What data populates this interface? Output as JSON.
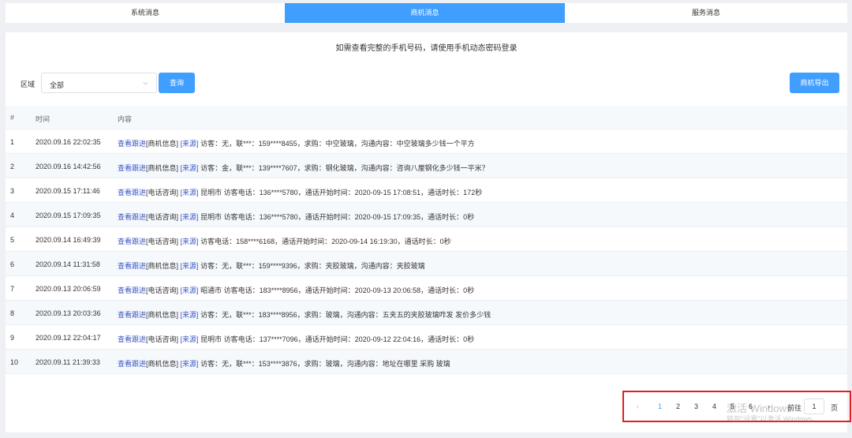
{
  "tabs": [
    {
      "label": "系统消息",
      "active": false
    },
    {
      "label": "商机消息",
      "active": true
    },
    {
      "label": "服务消息",
      "active": false
    }
  ],
  "notice": "如需查看完整的手机号码，请使用手机动态密码登录",
  "filter": {
    "label": "区域",
    "selected": "全部",
    "query_button": "查询",
    "export_button": "商机导出"
  },
  "table": {
    "headers": {
      "num": "#",
      "time": "时间",
      "content": "内容"
    },
    "rows": [
      {
        "num": "1",
        "time": "2020.09.16 22:02:35",
        "link": "查看跟进",
        "type": "[商机信息]",
        "source": "[来源]",
        "text": " 访客：无，联***：159****8455，求购：中空玻璃，沟通内容：中空玻璃多少钱一个平方"
      },
      {
        "num": "2",
        "time": "2020.09.16 14:42:56",
        "link": "查看跟进",
        "type": "[商机信息]",
        "source": "[来源]",
        "text": " 访客：金，联***：139****7607，求购：钢化玻璃，沟通内容：咨询八厘钢化多少钱一平米？"
      },
      {
        "num": "3",
        "time": "2020.09.15 17:11:46",
        "link": "查看跟进",
        "type": "[电话咨询]",
        "source": "[来源]",
        "text": " 昆明市 访客电话：136****5780，通话开始时间：2020-09-15 17:08:51，通话时长：172秒"
      },
      {
        "num": "4",
        "time": "2020.09.15 17:09:35",
        "link": "查看跟进",
        "type": "[电话咨询]",
        "source": "[来源]",
        "text": " 昆明市 访客电话：136****5780，通话开始时间：2020-09-15 17:09:35，通话时长：0秒"
      },
      {
        "num": "5",
        "time": "2020.09.14 16:49:39",
        "link": "查看跟进",
        "type": "[电话咨询]",
        "source": "[来源]",
        "text": " 访客电话：158****6168，通话开始时间：2020-09-14 16:19:30，通话时长：0秒"
      },
      {
        "num": "6",
        "time": "2020.09.14 11:31:58",
        "link": "查看跟进",
        "type": "[商机信息]",
        "source": "[来源]",
        "text": " 访客：无，联***：159****9396，求购：夹胶玻璃，沟通内容：夹胶玻璃"
      },
      {
        "num": "7",
        "time": "2020.09.13 20:06:59",
        "link": "查看跟进",
        "type": "[电话咨询]",
        "source": "[来源]",
        "text": " 昭通市 访客电话：183****8956，通话开始时间：2020-09-13 20:06:58，通话时长：0秒"
      },
      {
        "num": "8",
        "time": "2020.09.13 20:03:36",
        "link": "查看跟进",
        "type": "[商机信息]",
        "source": "[来源]",
        "text": " 访客：无，联***：183****8956，求购：玻璃，沟通内容：五夹五的夹胶玻璃咋发 发价多少钱"
      },
      {
        "num": "9",
        "time": "2020.09.12 22:04:17",
        "link": "查看跟进",
        "type": "[电话咨询]",
        "source": "[来源]",
        "text": " 昆明市 访客电话：137****7096，通话开始时间：2020-09-12 22:04:16，通话时长：0秒"
      },
      {
        "num": "10",
        "time": "2020.09.11 21:39:33",
        "link": "查看跟进",
        "type": "[商机信息]",
        "source": "[来源]",
        "text": " 访客：无，联***：153****3876，求购：玻璃，沟通内容：地址在哪里 采购 玻璃"
      }
    ]
  },
  "pagination": {
    "prev": "‹",
    "pages": [
      "1",
      "2",
      "3",
      "4",
      "5",
      "6"
    ],
    "current": "1",
    "next": "›",
    "goto_label": "前往",
    "goto_value": "1",
    "goto_suffix": "页"
  },
  "watermark": {
    "line1": "激活 Windows",
    "line2": "转到\"设置\"以激活 Windows。"
  },
  "colors": {
    "accent": "#409eff",
    "link": "#3a57c4",
    "highlight_border": "#e02020"
  }
}
